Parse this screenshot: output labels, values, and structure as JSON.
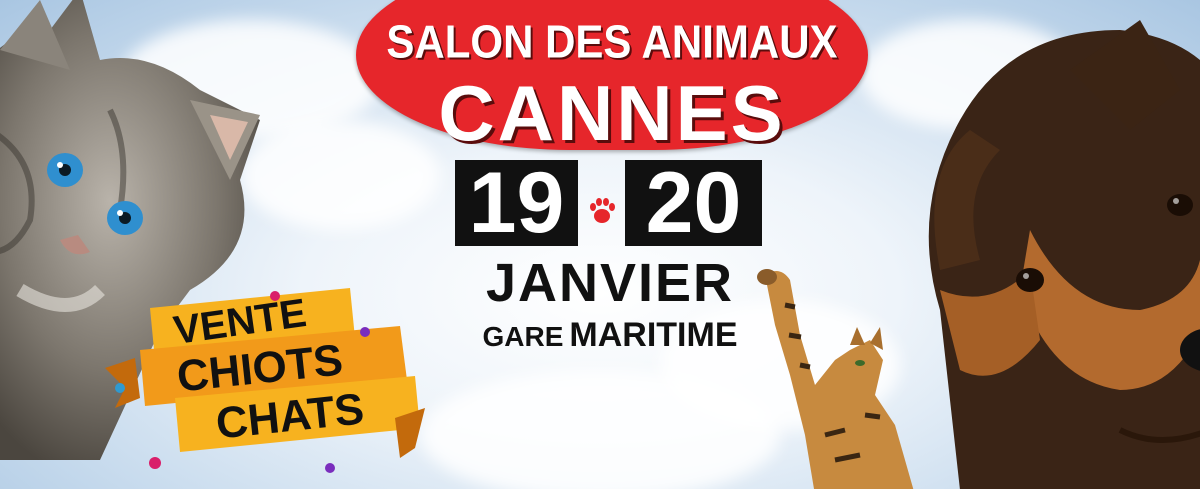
{
  "header": {
    "line1": "SALON DES ANIMAUX",
    "line2": "CANNES"
  },
  "dates": {
    "day1": "19",
    "day2": "20",
    "month": "JANVIER"
  },
  "venue": {
    "word1": "GARE",
    "word2": "MARITIME"
  },
  "ribbon": {
    "line1": "VENTE",
    "line2": "CHIOTS",
    "line3": "CHATS"
  },
  "colors": {
    "sign_red": "#e6262b",
    "date_box": "#111111",
    "ribbon_orange": "#f29a1a",
    "sky": "#c9dcee"
  },
  "icons": [
    "paw-icon",
    "kitten-image",
    "puppy-image",
    "bengal-cat-image"
  ]
}
